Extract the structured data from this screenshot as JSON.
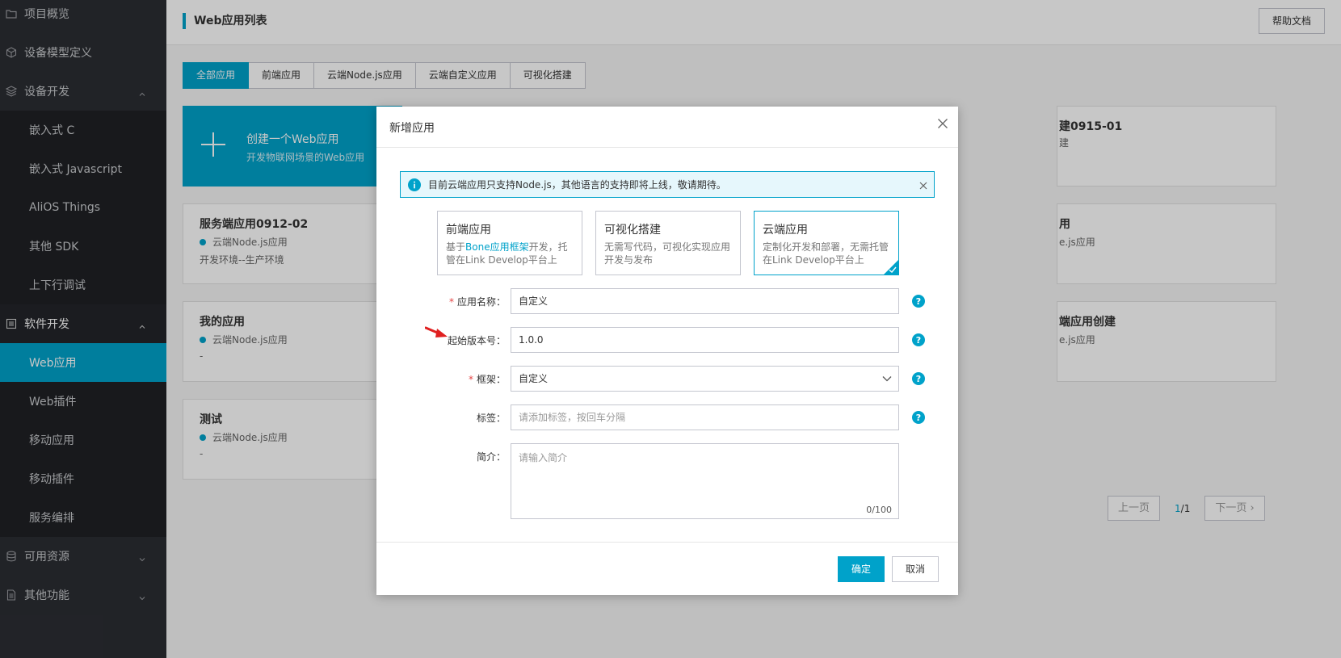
{
  "sidebar": {
    "items": [
      {
        "label": "项目概览",
        "icon": "folder-icon",
        "kind": "parent"
      },
      {
        "label": "设备模型定义",
        "icon": "cube-icon",
        "kind": "parent"
      },
      {
        "label": "设备开发",
        "icon": "layers-icon",
        "kind": "parent"
      },
      {
        "label": "嵌入式 C",
        "kind": "child"
      },
      {
        "label": "嵌入式 Javascript",
        "kind": "child"
      },
      {
        "label": "AliOS Things",
        "kind": "child"
      },
      {
        "label": "其他 SDK",
        "kind": "child"
      },
      {
        "label": "上下行调试",
        "kind": "child"
      },
      {
        "label": "软件开发",
        "icon": "list-icon",
        "kind": "parent"
      },
      {
        "label": "Web应用",
        "kind": "child",
        "active": true
      },
      {
        "label": "Web插件",
        "kind": "child"
      },
      {
        "label": "移动应用",
        "kind": "child"
      },
      {
        "label": "移动插件",
        "kind": "child"
      },
      {
        "label": "服务编排",
        "kind": "child"
      },
      {
        "label": "可用资源",
        "icon": "database-icon",
        "kind": "parent"
      },
      {
        "label": "其他功能",
        "icon": "document-icon",
        "kind": "parent"
      }
    ]
  },
  "header": {
    "title": "Web应用列表",
    "help_label": "帮助文档"
  },
  "tabs": [
    {
      "label": "全部应用",
      "active": true
    },
    {
      "label": "前端应用"
    },
    {
      "label": "云端Node.js应用"
    },
    {
      "label": "云端自定义应用"
    },
    {
      "label": "可视化搭建"
    }
  ],
  "create_card": {
    "title": "创建一个Web应用",
    "subtitle": "开发物联网场景的Web应用"
  },
  "cards": [
    {
      "title": "服务端应用0912-02",
      "type": "云端Node.js应用",
      "desc": "开发环境--生产环境"
    },
    {
      "title": "我的应用",
      "type": "云端Node.js应用",
      "desc": "-"
    },
    {
      "title": "测试",
      "type": "云端Node.js应用",
      "desc": "-"
    }
  ],
  "right_cards": [
    {
      "title": "建0915-01",
      "type": "",
      "desc": "建"
    },
    {
      "title": "用",
      "type": "e.js应用",
      "desc": ""
    },
    {
      "title": "端应用创建",
      "type": "e.js应用",
      "desc": ""
    }
  ],
  "pager": {
    "prev": "上一页",
    "current": "1",
    "total": "/1",
    "next": "下一页"
  },
  "modal": {
    "title": "新增应用",
    "notice": "目前云端应用只支持Node.js，其他语言的支持即将上线，敬请期待。",
    "type_cards": [
      {
        "title": "前端应用",
        "desc_pre": "基于",
        "desc_link": "Bone应用框架",
        "desc_post": "开发，托管在Link Develop平台上"
      },
      {
        "title": "可视化搭建",
        "desc": "无需写代码，可视化实现应用开发与发布"
      },
      {
        "title": "云端应用",
        "desc": "定制化开发和部署，无需托管在Link Develop平台上",
        "selected": true
      }
    ],
    "fields": {
      "name_label": "应用名称：",
      "name_value": "自定义",
      "version_label": "起始版本号：",
      "version_value": "1.0.0",
      "framework_label": "框架：",
      "framework_value": "自定义",
      "tags_label": "标签：",
      "tags_placeholder": "请添加标签，按回车分隔",
      "intro_label": "简介：",
      "intro_placeholder": "请输入简介",
      "intro_count": "0/100"
    },
    "ok_label": "确定",
    "cancel_label": "取消"
  },
  "colors": {
    "accent": "#00a2ca",
    "sidebar_bg": "#2b2d33",
    "required": "#e54545",
    "annotation_arrow": "#e02020"
  }
}
